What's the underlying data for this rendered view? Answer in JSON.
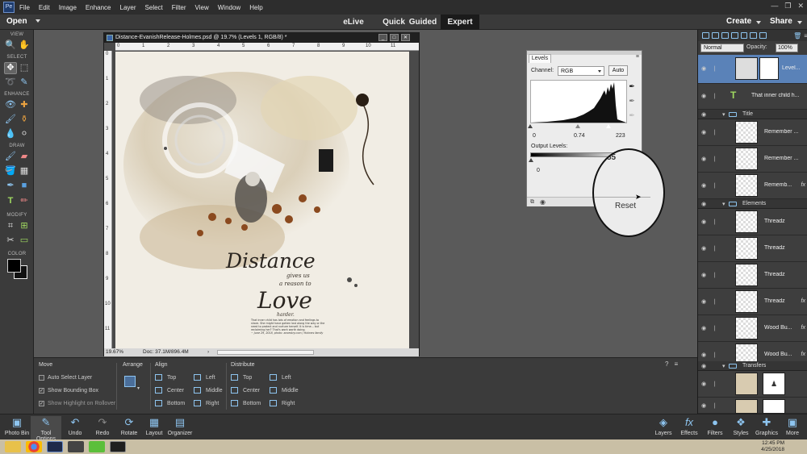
{
  "menu": [
    "File",
    "Edit",
    "Image",
    "Enhance",
    "Layer",
    "Select",
    "Filter",
    "View",
    "Window",
    "Help"
  ],
  "modebar": {
    "open": "Open",
    "modes": [
      "eLive",
      "Quick",
      "Guided",
      "Expert"
    ],
    "active": "Expert",
    "create": "Create",
    "share": "Share"
  },
  "toolbox": {
    "sections": [
      "VIEW",
      "SELECT",
      "ENHANCE",
      "DRAW",
      "MODIFY",
      "COLOR"
    ]
  },
  "document": {
    "title": "Distance-EvanishRelease-Holmes.psd @ 19.7% (Levels 1, RGB/8) *",
    "ruler_top": [
      "0",
      "1",
      "2",
      "3",
      "4",
      "5",
      "6",
      "7",
      "8",
      "9",
      "10",
      "11"
    ],
    "ruler_left": [
      "0",
      "1",
      "2",
      "3",
      "4",
      "5",
      "6",
      "7",
      "8",
      "9",
      "10",
      "11"
    ],
    "zoom": "19.67%",
    "doc": "Doc: 37.1M/896.4M",
    "art": {
      "word1": "Distance",
      "line2": "gives us",
      "line3": "a reason to",
      "word2": "Love",
      "line5": "harder.",
      "journal": "That inner child has lots of emotion and feelings to share. She might have gotten lost along the way or the need to protect and nurture herself. It is time... but reclaiming her? That's work worth doing.",
      "journal_date": "~ June 29, 2018, photo: ancestry.com / Holmes family"
    }
  },
  "levels": {
    "tab": "Levels",
    "channel_label": "Channel:",
    "channel": "RGB",
    "auto": "Auto",
    "input_values": [
      "0",
      "0.74",
      "223"
    ],
    "output_label": "Output Levels:",
    "output_min": "0",
    "input_black": 0,
    "input_gray": 0.74,
    "input_white": 223
  },
  "magnifier": {
    "reset": "Reset",
    "fragment": "55"
  },
  "layers_panel": {
    "blend": "Normal",
    "opacity_label": "Opacity:",
    "opacity": "100%",
    "layers": [
      {
        "name": "Level...",
        "type": "adjustment",
        "selected": true
      },
      {
        "name": "That inner child h...",
        "type": "text"
      },
      {
        "name": "Title",
        "type": "group"
      },
      {
        "name": "Remember ...",
        "type": "layer"
      },
      {
        "name": "Remember ...",
        "type": "layer"
      },
      {
        "name": "Rememb...",
        "type": "layer",
        "fx": "fx"
      },
      {
        "name": "Elements",
        "type": "group"
      },
      {
        "name": "Threadz",
        "type": "layer"
      },
      {
        "name": "Threadz",
        "type": "layer"
      },
      {
        "name": "Threadz",
        "type": "layer"
      },
      {
        "name": "Threadz",
        "type": "layer",
        "fx": "fx"
      },
      {
        "name": "Wood Bu...",
        "type": "layer",
        "fx": "fx"
      },
      {
        "name": "Wood Bu...",
        "type": "layer",
        "fx": "fx"
      },
      {
        "name": "Transfers",
        "type": "group"
      },
      {
        "name": "",
        "type": "layer"
      },
      {
        "name": "",
        "type": "layer"
      }
    ]
  },
  "options": {
    "move": {
      "title": "Move",
      "auto_select": "Auto Select Layer",
      "show_bbox": "Show Bounding Box",
      "show_highlight": "Show Highlight on Rollover"
    },
    "arrange": {
      "title": "Arrange"
    },
    "align": {
      "title": "Align",
      "items": [
        "Top",
        "Left",
        "Center",
        "Middle",
        "Bottom",
        "Right"
      ]
    },
    "distribute": {
      "title": "Distribute",
      "items": [
        "Top",
        "Left",
        "Center",
        "Middle",
        "Bottom",
        "Right"
      ]
    }
  },
  "bottombar": {
    "left": [
      "Photo Bin",
      "Tool Options",
      "Undo",
      "Redo",
      "Rotate",
      "Layout",
      "Organizer"
    ],
    "right": [
      "Layers",
      "Effects",
      "Filters",
      "Styles",
      "Graphics",
      "More"
    ]
  },
  "taskbar": {
    "time": "12:45 PM",
    "date": "4/25/2018"
  },
  "colors": {
    "accent": "#5a82b8",
    "ui_dark": "#2d2d2d",
    "panel": "#3c3c3c"
  }
}
